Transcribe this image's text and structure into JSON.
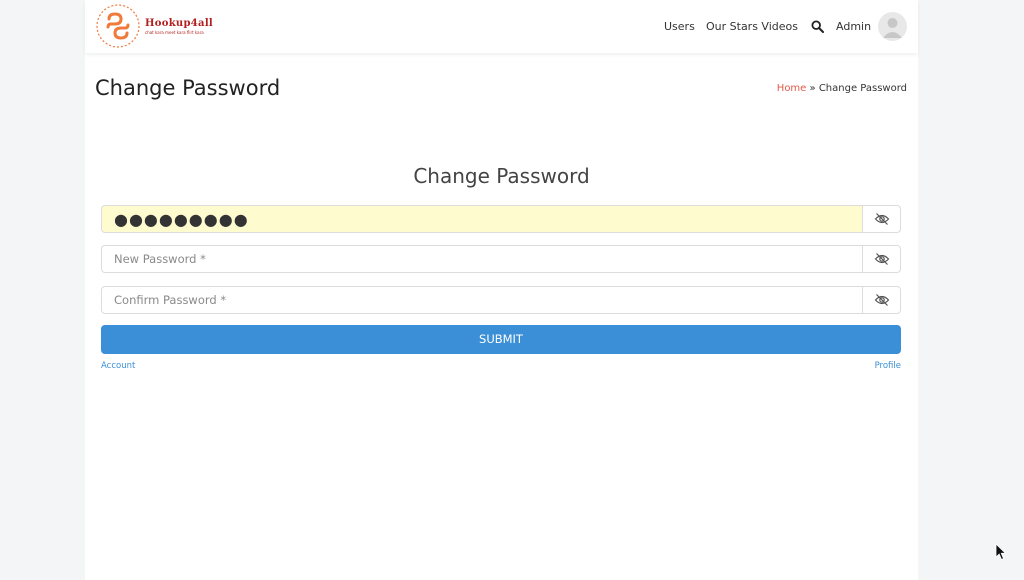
{
  "header": {
    "logo": {
      "name": "Hookup4all",
      "tagline": "chat kara meet kara flirt kara",
      "ring_text": "Hookup4all",
      "brand_color": "#b21f1f",
      "mark_color": "#f07a3c"
    },
    "nav": {
      "users_label": "Users",
      "stars_label": "Our Stars Videos",
      "search_icon": "search-icon",
      "admin_label": "Admin",
      "avatar_icon": "user-avatar-icon"
    }
  },
  "page": {
    "title": "Change Password",
    "breadcrumb": {
      "home": "Home",
      "separator": " » ",
      "current": "Change Password"
    }
  },
  "form": {
    "title": "Change Password",
    "current_password": {
      "value": "●●●●●●●●●",
      "placeholder": "",
      "autofill_color": "#fefbcf",
      "toggle_icon": "eye-slash-icon"
    },
    "new_password": {
      "value": "",
      "placeholder": "New Password *",
      "toggle_icon": "eye-slash-icon"
    },
    "confirm_password": {
      "value": "",
      "placeholder": "Confirm Password *",
      "toggle_icon": "eye-slash-icon"
    },
    "submit_label": "SUBMIT",
    "submit_color": "#3b8fd6",
    "account_link": "Account",
    "profile_link": "Profile"
  },
  "colors": {
    "breadcrumb_link": "#e05a4a",
    "link": "#3b8fd6",
    "page_background": "#f4f5f7"
  }
}
